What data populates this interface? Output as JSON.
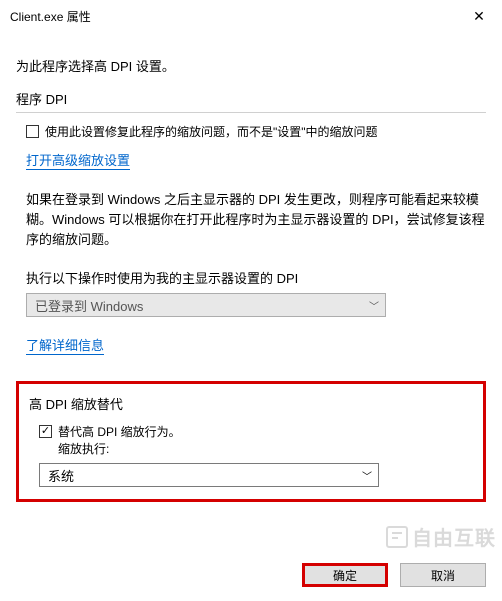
{
  "window": {
    "title": "Client.exe 属性",
    "close": "✕"
  },
  "intro": "为此程序选择高 DPI 设置。",
  "sectionProgramDpi": {
    "label": "程序 DPI",
    "checkbox_label": "使用此设置修复此程序的缩放问题，而不是\"设置\"中的缩放问题",
    "link": "打开高级缩放设置",
    "description": "如果在登录到 Windows 之后主显示器的 DPI 发生更改，则程序可能看起来较模糊。Windows 可以根据你在打开此程序时为主显示器设置的 DPI，尝试修复该程序的缩放问题。",
    "whenLabel": "执行以下操作时使用为我的主显示器设置的 DPI",
    "select_value": "已登录到 Windows",
    "link2": "了解详细信息"
  },
  "sectionOverride": {
    "label": "高 DPI 缩放替代",
    "checkbox_checked": true,
    "checkbox_label": "替代高 DPI 缩放行为。",
    "sublabel": "缩放执行:",
    "select_value": "系统"
  },
  "footer": {
    "ok": "确定",
    "cancel": "取消"
  },
  "watermark": "自由互联",
  "icons": {
    "chevron": "﹀",
    "check": "✓"
  }
}
